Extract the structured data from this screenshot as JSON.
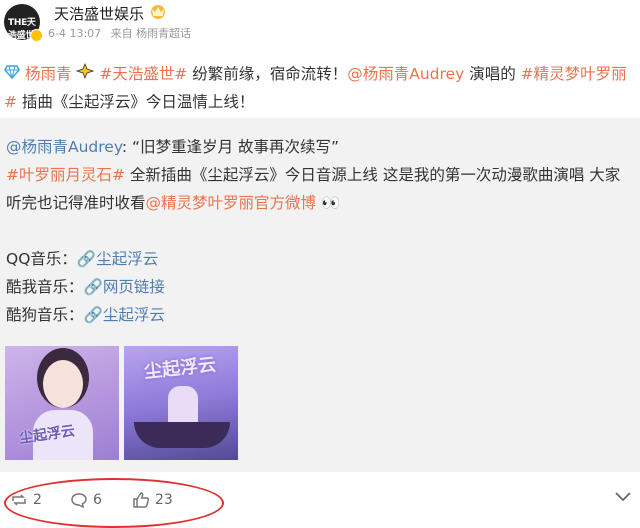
{
  "account": {
    "avatar_text": "THE天浩盛世",
    "name": "天浩盛世娱乐",
    "time": "6-4 13:07",
    "source_prefix": "来自",
    "source": "杨雨青超话"
  },
  "post": {
    "tag_yang": "杨雨青",
    "tag_tianhao": "#天浩盛世#",
    "text1": " 纷繁前缘，宿命流转！",
    "mention_audrey": "@杨雨青Audrey",
    "text2": " 演唱的 ",
    "tag_jingling": "#精灵梦叶罗丽#",
    "text3": " 插曲《尘起浮云》今日温情上线！"
  },
  "repost": {
    "mention": "@杨雨青Audrey",
    "quote": ": “旧梦重逢岁月 故事再次续写”",
    "tag_yueling": "#叶罗丽月灵石#",
    "text1": " 全新插曲《尘起浮云》今日音源上线 这是我的第一次动漫歌曲演唱 大家听完也记得准时收看",
    "mention_official": "@精灵梦叶罗丽官方微博",
    "eyes": "👀",
    "qq_label": "QQ音乐：",
    "qq_link": "尘起浮云",
    "kuwo_label": "酷我音乐：",
    "kuwo_link": "网页链接",
    "kugou_label": "酷狗音乐：",
    "kugou_link": "尘起浮云",
    "thumb1_caption": "尘起浮云",
    "thumb2_caption": "尘起浮云"
  },
  "footer": {
    "repost_count": "2",
    "comment_count": "6",
    "like_count": "23"
  },
  "colors": {
    "link": "#eb7350",
    "blue_link": "#507daf",
    "highlight": "#e03131"
  },
  "icons": [
    "crown-icon",
    "diamond-icon",
    "sparkle-icon",
    "link-icon",
    "repost-icon",
    "comment-icon",
    "like-icon",
    "chevron-down-icon"
  ]
}
